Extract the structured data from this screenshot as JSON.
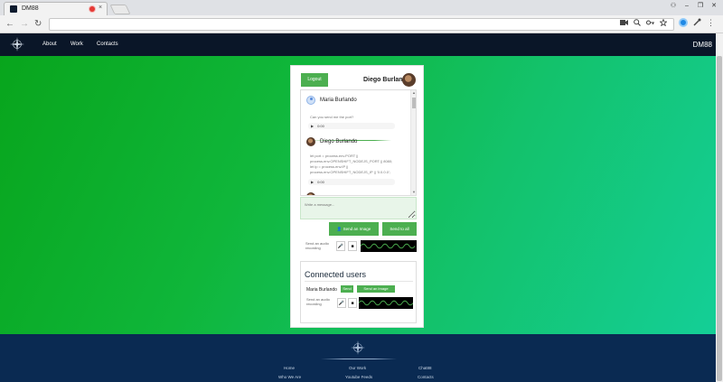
{
  "browser": {
    "tab_title": "DM88",
    "tab_close": "×",
    "win_controls": [
      "⚇",
      "–",
      "❐",
      "✕"
    ],
    "nav_back": "←",
    "nav_forward": "→",
    "nav_reload": "↻",
    "omnibox_icons": [
      "camera-icon",
      "zoom-icon",
      "key-icon",
      "star-icon"
    ],
    "ext_menu": "⋮"
  },
  "navbar": {
    "links": [
      "About",
      "Work",
      "Contacts"
    ],
    "brand": "DM88"
  },
  "chat": {
    "logout_label": "Logout",
    "current_user": "Diego Burlando",
    "messages": [
      {
        "author": "Maria Burlando",
        "text": "Can you send me the port?",
        "audio_time": "0:00"
      },
      {
        "author": "Diego Burlando",
        "text_lines": [
          "let port = process.env.PORT ||",
          "process.env.OPENSHIFT_NODEJS_PORT || 8080;",
          "let ip = process.env.IP ||",
          "process.env.OPENSHIFT_NODEJS_IP || '0.0.0.0';"
        ],
        "audio_time": "0:00"
      }
    ],
    "input_placeholder": "Write a message...",
    "send_image_label": "Send an Image",
    "send_all_label": "Send to all",
    "recording_label": "Send an audio recording",
    "mic_symbol": "🎤",
    "stop_symbol": "■"
  },
  "connected_users": {
    "title": "Connected users",
    "users": [
      {
        "name": "Maria Burlando",
        "send_label": "Send",
        "send_image_label": "Send an Image",
        "recording_label": "Send an audio recording"
      }
    ]
  },
  "footer": {
    "columns": [
      [
        "Home",
        "Who We Are"
      ],
      [
        "Our Work",
        "Youtube Feeds"
      ],
      [
        "Chat88",
        "Contacts"
      ]
    ]
  },
  "colors": {
    "accent_green": "#4caf50",
    "navbar": "#0a1628",
    "footer": "#0a2a52",
    "wave": "#4caf50"
  }
}
